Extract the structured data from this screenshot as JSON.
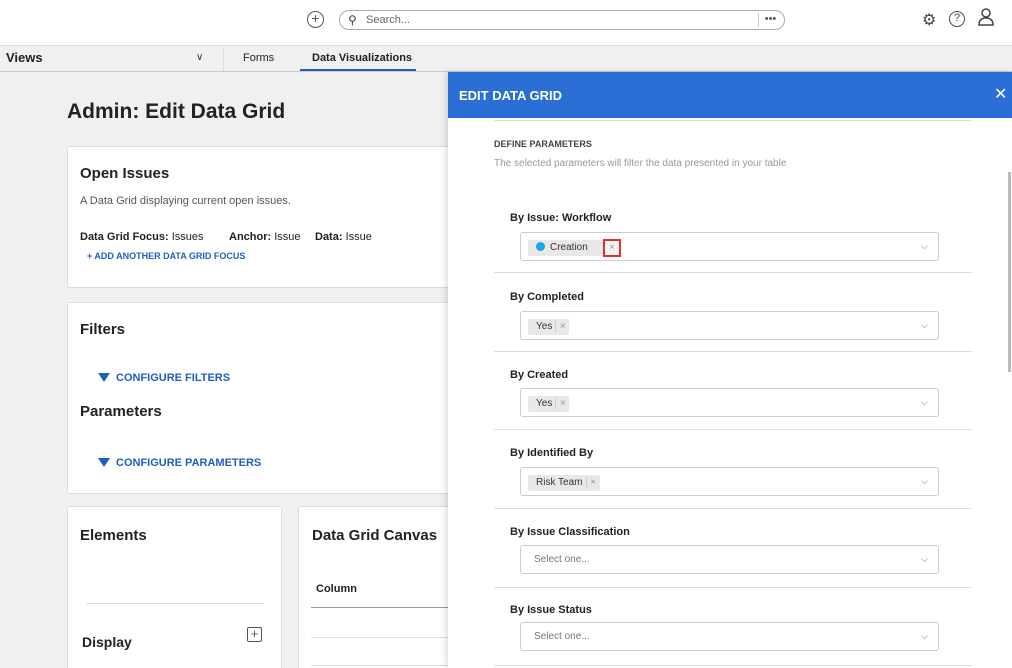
{
  "topbar": {
    "add_icon": "plus-circle-icon",
    "search_placeholder": "Search...",
    "more_label": "•••",
    "settings_icon": "gear-icon",
    "help_icon": "question-icon",
    "user_icon": "user-icon"
  },
  "nav": {
    "views_label": "Views",
    "tabs": [
      {
        "label": "Forms"
      },
      {
        "label": "Data Visualizations"
      }
    ]
  },
  "page": {
    "title_prefix": "Admin",
    "title_sep": ":",
    "title_main": "Edit Data Grid"
  },
  "open_issues_card": {
    "title": "Open Issues",
    "description": "A Data Grid displaying current open issues.",
    "focus_label": "Data Grid Focus:",
    "focus_value": "Issues",
    "anchor_label": "Anchor:",
    "anchor_value": "Issue",
    "data_label": "Data:",
    "data_value": "Issue",
    "add_focus_link": "+ ADD ANOTHER DATA GRID FOCUS"
  },
  "filters_card": {
    "filters_title": "Filters",
    "configure_filters": "CONFIGURE FILTERS",
    "parameters_title": "Parameters",
    "configure_parameters": "CONFIGURE PARAMETERS"
  },
  "elements_card": {
    "title": "Elements",
    "display_label": "Display"
  },
  "canvas_card": {
    "title": "Data Grid Canvas",
    "column_label": "Column"
  },
  "panel": {
    "title": "EDIT DATA GRID",
    "section_title": "DEFINE PARAMETERS",
    "section_subtitle": "The selected parameters will filter the data presented in your table",
    "params": [
      {
        "label": "By Issue: Workflow",
        "value": "Creation"
      },
      {
        "label": "By Completed",
        "value": "Yes"
      },
      {
        "label": "By Created",
        "value": "Yes"
      },
      {
        "label": "By Identified By",
        "value": "Risk Team"
      },
      {
        "label": "By Issue Classification",
        "placeholder": "Select one..."
      },
      {
        "label": "By Issue Status",
        "placeholder": "Select one..."
      }
    ],
    "remove_glyph": "×",
    "chevron_glyph": "⌵"
  },
  "colors": {
    "accent": "#2b6fd6",
    "link": "#1f5fbf",
    "workflow_dot": "#1aa6e8",
    "highlight": "#e03030"
  }
}
